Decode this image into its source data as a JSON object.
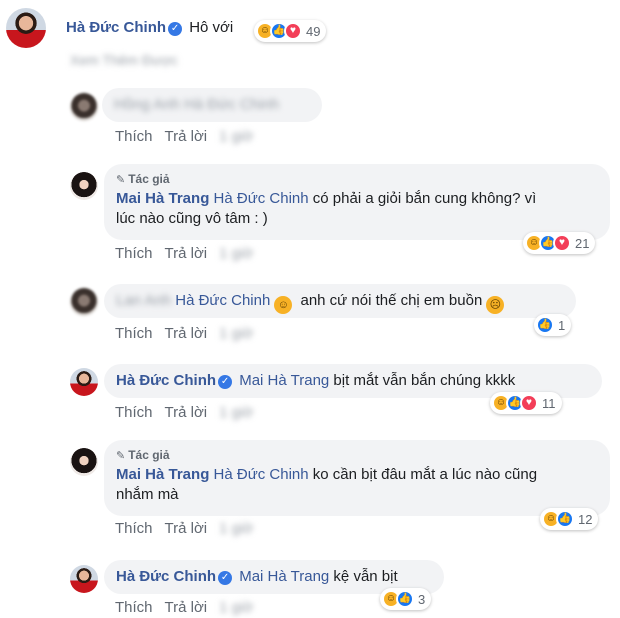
{
  "comments": [
    {
      "name": "Hà Đức Chinh",
      "text": "Hô với",
      "below_text": "Xem Thêm Được",
      "reactions": {
        "count": "49",
        "types": [
          "haha",
          "like",
          "love"
        ]
      }
    },
    {
      "blurred_name": "Hồng Anh",
      "mention": "Hà Đức Chinh",
      "actions": {
        "like": "Thích",
        "reply": "Trả lời",
        "time": "1 giờ"
      }
    },
    {
      "author_badge": "Tác giả",
      "name": "Mai Hà Trang",
      "mention": "Hà Đức Chinh",
      "text_line1": " có phải a giỏi bắn cung không? vì",
      "text_line2": "lúc nào cũng vô tâm : )",
      "actions": {
        "like": "Thích",
        "reply": "Trả lời",
        "time": "1 giờ"
      },
      "reactions": {
        "count": "21",
        "types": [
          "haha",
          "like",
          "love"
        ]
      }
    },
    {
      "blurred_name": "Lan Anh",
      "mention": "Hà Đức Chinh",
      "text_a": " anh cứ nói thế chị em buồn",
      "actions": {
        "like": "Thích",
        "reply": "Trả lời",
        "time": "1 giờ"
      },
      "reactions": {
        "count": "1",
        "types": [
          "like"
        ]
      }
    },
    {
      "name": "Hà Đức Chinh",
      "mention": "Mai Hà Trang",
      "text": " bịt mắt vẫn bắn chúng kkkk",
      "actions": {
        "like": "Thích",
        "reply": "Trả lời",
        "time": "1 giờ"
      },
      "reactions": {
        "count": "11",
        "types": [
          "haha",
          "like",
          "love"
        ]
      }
    },
    {
      "author_badge": "Tác giả",
      "name": "Mai Hà Trang",
      "mention": "Hà Đức Chinh",
      "text_line1": " ko cần bịt đâu mắt a lúc nào cũng",
      "text_line2": "nhắm mà",
      "actions": {
        "like": "Thích",
        "reply": "Trả lời",
        "time": "1 giờ"
      },
      "reactions": {
        "count": "12",
        "types": [
          "haha",
          "like"
        ]
      }
    },
    {
      "name": "Hà Đức Chinh",
      "mention": "Mai Hà Trang",
      "text": " kệ vẫn bịt",
      "actions": {
        "like": "Thích",
        "reply": "Trả lời",
        "time": "1 giờ"
      },
      "reactions": {
        "count": "3",
        "types": [
          "haha",
          "like"
        ]
      }
    }
  ],
  "colors": {
    "link": "#385898",
    "bubble": "#f2f3f5",
    "meta": "#606770"
  }
}
